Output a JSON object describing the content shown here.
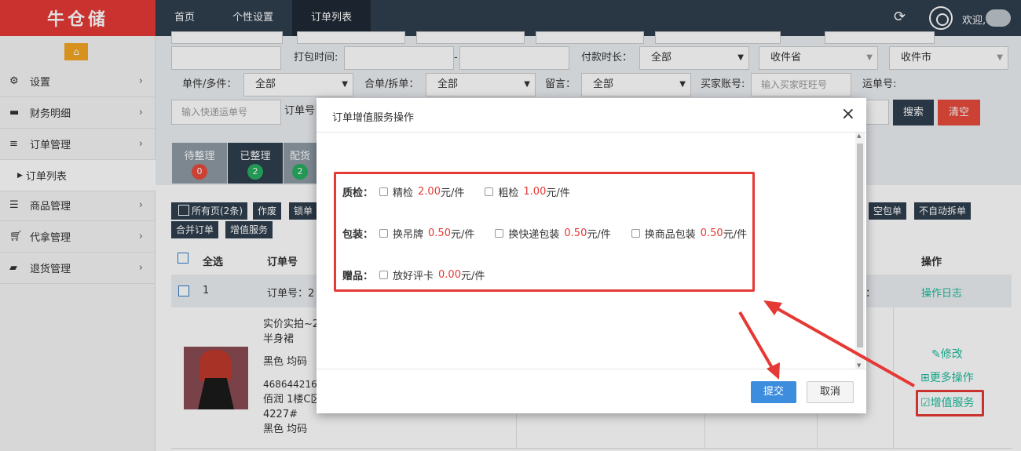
{
  "app": {
    "logo": "牛仓储"
  },
  "nav": {
    "items": [
      "首页",
      "个性设置",
      "订单列表"
    ],
    "welcome": "欢迎,"
  },
  "sidebar": {
    "items": [
      "设置",
      "财务明细",
      "订单管理",
      "订单列表",
      "商品管理",
      "代拿管理",
      "退货管理"
    ]
  },
  "filters": {
    "pack_time_label": "打包时间:",
    "dash": "-",
    "pay_duration_label": "付款时长：",
    "pay_duration_value": "全部",
    "province_value": "收件省",
    "city_value": "收件市",
    "single_multi_label": "单件/多件：",
    "single_multi_value": "全部",
    "merge_split_label": "合单/拆单：",
    "merge_split_value": "全部",
    "message_label": "留言：",
    "message_value": "全部",
    "buyer_label": "买家账号:",
    "buyer_placeholder": "输入买家旺旺号",
    "waybill_label": "运单号:",
    "express_placeholder": "输入快递运单号",
    "order_no_label": "订单号",
    "search": "搜索",
    "clear": "清空"
  },
  "status_tiles": [
    {
      "label": "待整理",
      "count": "0",
      "color": "#e74c3c"
    },
    {
      "label": "已整理",
      "count": "2",
      "color": "#27ae60"
    },
    {
      "label": "配货",
      "count": "2",
      "color": "#27ae60"
    }
  ],
  "order_buttons": {
    "all_pages": "所有页(2条)",
    "void": "作废",
    "lock": "锁单",
    "empty_pkg": "空包单",
    "no_auto_split": "不自动拆单",
    "merge": "合并订单",
    "value_added": "增值服务"
  },
  "table": {
    "select_all": "全选",
    "order_no": "订单号",
    "operation": "操作",
    "row_index": "1",
    "row_order_label": "订单号：2",
    "colon": "：",
    "op_log": "操作日志"
  },
  "product": {
    "title1": "实价实拍~2",
    "title2": "半身裙",
    "spec": "黑色 均码",
    "code": "4686442163",
    "location": "佰润 1楼C区",
    "loc_num": "4227#",
    "spec2": "黑色 均码"
  },
  "ops": {
    "edit": "修改",
    "more": "更多操作",
    "value_added": "增值服务"
  },
  "modal": {
    "title": "订单增值服务操作",
    "groups": [
      {
        "label": "质检：",
        "items": [
          {
            "name": "精检",
            "price": "2.00",
            "unit": "元/件"
          },
          {
            "name": "粗检",
            "price": "1.00",
            "unit": "元/件"
          }
        ]
      },
      {
        "label": "包装：",
        "items": [
          {
            "name": "换吊牌",
            "price": "0.50",
            "unit": "元/件"
          },
          {
            "name": "换快递包装",
            "price": "0.50",
            "unit": "元/件"
          },
          {
            "name": "换商品包装",
            "price": "0.50",
            "unit": "元/件"
          }
        ]
      },
      {
        "label": "赠品：",
        "items": [
          {
            "name": "放好评卡",
            "price": "0.00",
            "unit": "元/件"
          }
        ]
      }
    ],
    "submit": "提交",
    "cancel": "取消"
  },
  "colors": {
    "topbar": "#2f3e4e",
    "brand": "#e53935",
    "accent": "#1abc9c",
    "primary": "#3c8dde"
  }
}
